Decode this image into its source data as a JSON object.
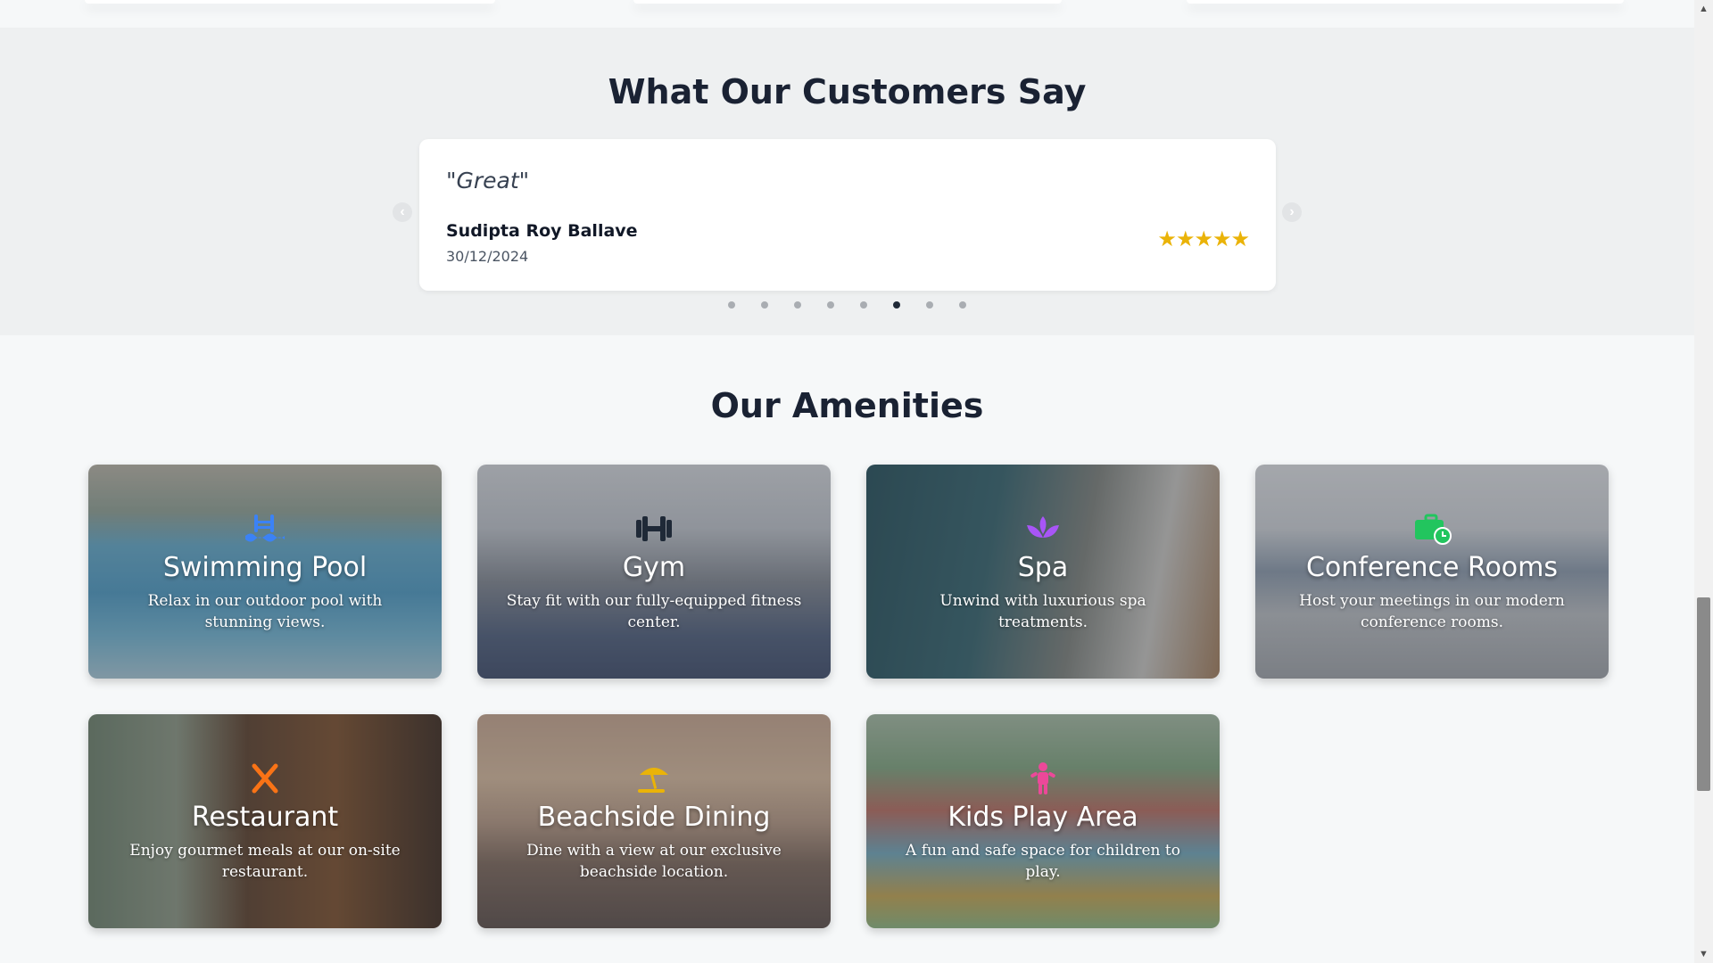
{
  "testimonials": {
    "title": "What Our Customers Say",
    "review": {
      "quote": "\"Great\"",
      "reviewer": "Sudipta Roy Ballave",
      "date": "30/12/2024",
      "rating": 5,
      "stars": "★★★★★"
    },
    "prev_label": "‹",
    "next_label": "›",
    "dots_count": 8,
    "active_dot": 6,
    "star_color": "#eab308"
  },
  "amenities": {
    "title": "Our Amenities",
    "items": [
      {
        "title": "Swimming Pool",
        "desc": "Relax in our outdoor pool with stunning views.",
        "icon": "swimmer-icon",
        "icon_color": "#3b82f6"
      },
      {
        "title": "Gym",
        "desc": "Stay fit with our fully-equipped fitness center.",
        "icon": "dumbbell-icon",
        "icon_color": "#1f2937"
      },
      {
        "title": "Spa",
        "desc": "Unwind with luxurious spa treatments.",
        "icon": "spa-lotus-icon",
        "icon_color": "#a855f7"
      },
      {
        "title": "Conference Rooms",
        "desc": "Host your meetings in our modern conference rooms.",
        "icon": "briefcase-clock-icon",
        "icon_color": "#22c55e"
      },
      {
        "title": "Restaurant",
        "desc": "Enjoy gourmet meals at our on-site restaurant.",
        "icon": "utensils-icon",
        "icon_color": "#f97316"
      },
      {
        "title": "Beachside Dining",
        "desc": "Dine with a view at our exclusive beachside location.",
        "icon": "umbrella-beach-icon",
        "icon_color": "#eab308"
      },
      {
        "title": "Kids Play Area",
        "desc": "A fun and safe space for children to play.",
        "icon": "child-icon",
        "icon_color": "#ec4899"
      }
    ]
  }
}
